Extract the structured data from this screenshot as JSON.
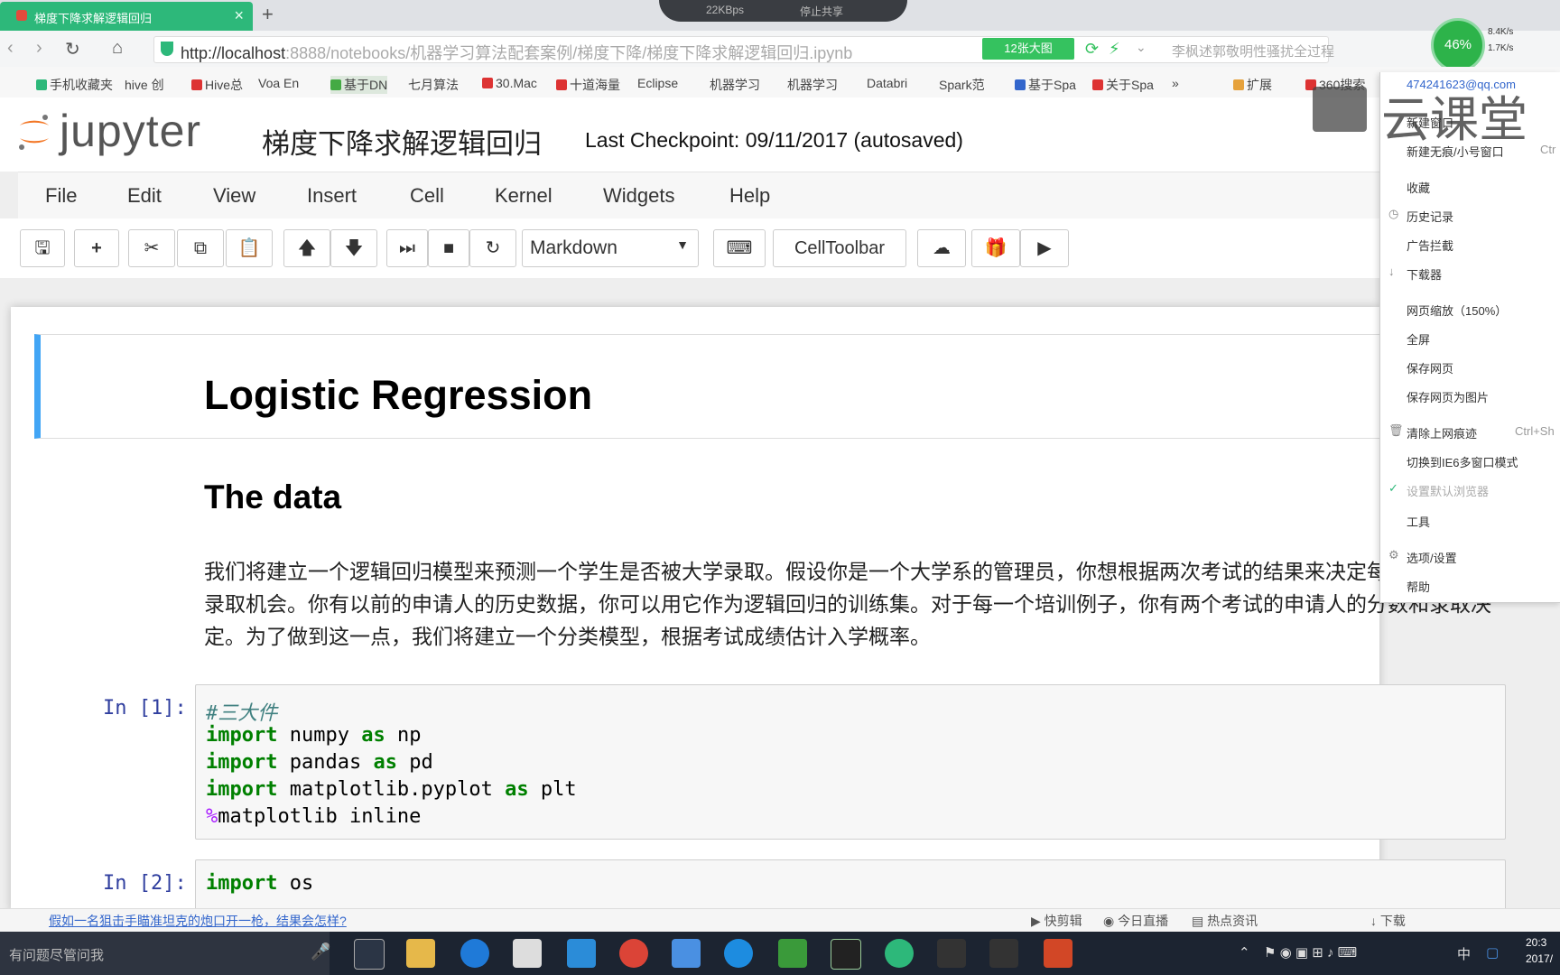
{
  "browser": {
    "tab_title": "梯度下降求解逻辑回归",
    "new_tab": "+",
    "net_speed": "22KBps",
    "stop_share": "停止共享",
    "url_host": "http://localhost",
    "url_path": ":8888/notebooks/机器学习算法配套案例/梯度下降/梯度下降求解逻辑回归.ipynb",
    "big_image_btn": "12张大图",
    "search_hint": "李枫述郭敬明性骚扰全过程",
    "cpu": "46%",
    "up_speed": "8.4K/s",
    "down_speed": "1.7K/s",
    "bookmarks": [
      "手机收藏夹",
      "hive 创",
      "Hive总",
      "Voa En",
      "基于DN",
      "七月算法",
      "30.Mac",
      "十道海量",
      "Eclipse",
      "机器学习",
      "机器学习",
      "Databri",
      "Spark范",
      "基于Spa",
      "关于Spa",
      "»",
      "扩展",
      "360搜索"
    ]
  },
  "jupyter": {
    "logo_text": "jupyter",
    "notebook_title": "梯度下降求解逻辑回归",
    "checkpoint": "Last Checkpoint: 09/11/2017 (autosaved)",
    "menu": [
      "File",
      "Edit",
      "View",
      "Insert",
      "Cell",
      "Kernel",
      "Widgets",
      "Help"
    ],
    "cell_type": "Markdown",
    "celltoolbar": "CellToolbar"
  },
  "notebook": {
    "h1": "Logistic Regression",
    "h2": "The data",
    "paragraph": "我们将建立一个逻辑回归模型来预测一个学生是否被大学录取。假设你是一个大学系的管理员，你想根据两次考试的结果来决定每个申请人的录取机会。你有以前的申请人的历史数据，你可以用它作为逻辑回归的训练集。对于每一个培训例子，你有两个考试的申请人的分数和录取决定。为了做到这一点，我们将建立一个分类模型，根据考试成绩估计入学概率。",
    "cell1_prompt": "In [1]:",
    "cell1": {
      "comment": "#三大件",
      "l1_kw": "import",
      "l1_a": " numpy ",
      "l1_kw2": "as",
      "l1_b": " np",
      "l2_kw": "import",
      "l2_a": " pandas ",
      "l2_kw2": "as",
      "l2_b": " pd",
      "l3_kw": "import",
      "l3_a": " matplotlib.pyplot ",
      "l3_kw2": "as",
      "l3_b": " plt",
      "l4_mg": "%",
      "l4_rest": "matplotlib inline"
    },
    "cell2_prompt": "In [2]:",
    "cell2": {
      "l1_kw": "import",
      "l1_a": " os"
    }
  },
  "context_menu": {
    "user": "474241623@qq.com",
    "items": [
      "新建窗口",
      "新建无痕/小号窗口",
      "收藏",
      "历史记录",
      "广告拦截",
      "下载器",
      "网页缩放（150%）",
      "全屏",
      "保存网页",
      "保存网页为图片",
      "清除上网痕迹",
      "切换到IE6多窗口模式",
      "设置默认浏览器",
      "工具",
      "选项/设置",
      "帮助"
    ],
    "shortcut_new": "Ctr",
    "shortcut_clear": "Ctrl+Sh"
  },
  "watermark": "云课堂",
  "statusbar": {
    "news": "假如一名狙击手瞄准坦克的炮口开一枪，结果会怎样?",
    "items": [
      "快剪辑",
      "今日直播",
      "热点资讯",
      "下载"
    ]
  },
  "taskbar": {
    "search": "有问题尽管问我",
    "time": "20:3",
    "date": "2017/",
    "ime": "中"
  },
  "colors": {
    "accent": "#2db87a",
    "cell_selected": "#42a5f5",
    "keyword": "#008000",
    "prompt": "#303f9f"
  }
}
